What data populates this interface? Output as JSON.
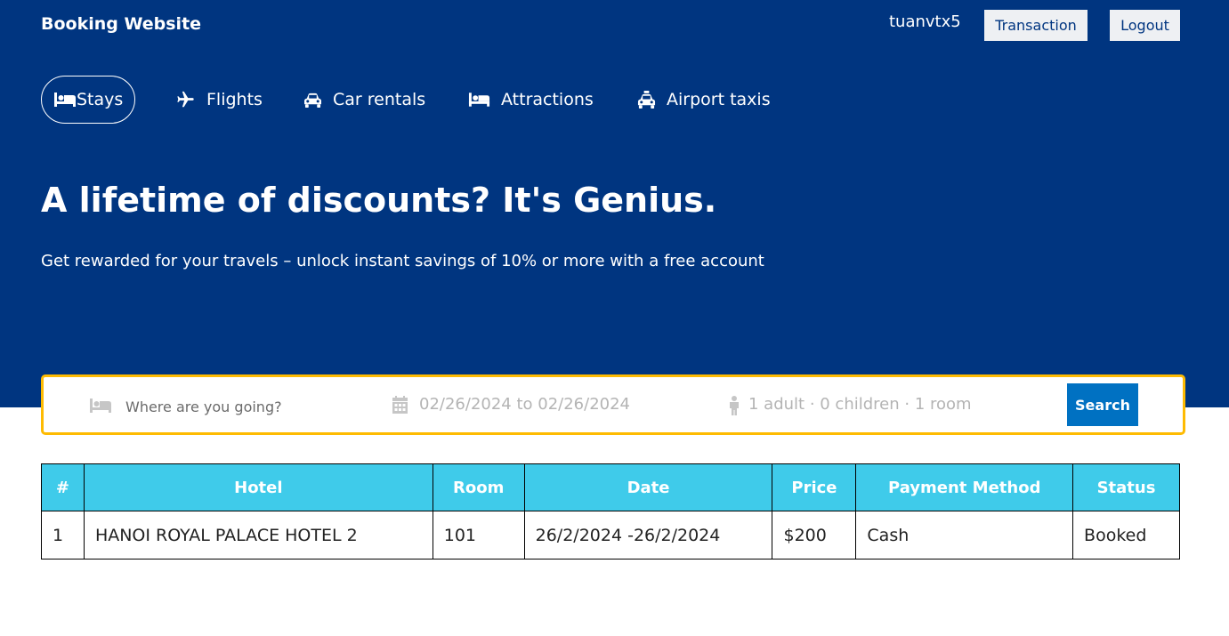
{
  "header": {
    "logo": "Booking Website",
    "username": "tuanvtx5",
    "transaction_label": "Transaction",
    "logout_label": "Logout"
  },
  "nav": {
    "items": [
      {
        "label": "Stays",
        "icon": "bed-icon",
        "active": true
      },
      {
        "label": "Flights",
        "icon": "plane-icon"
      },
      {
        "label": "Car rentals",
        "icon": "car-icon"
      },
      {
        "label": "Attractions",
        "icon": "bed-icon"
      },
      {
        "label": "Airport taxis",
        "icon": "taxi-icon"
      }
    ]
  },
  "hero": {
    "title": "A lifetime of discounts? It's Genius.",
    "subtitle": "Get rewarded for your travels – unlock instant savings of 10% or more with a free account"
  },
  "search": {
    "destination_placeholder": "Where are you going?",
    "date_range": "02/26/2024 to 02/26/2024",
    "guests": "1 adult · 0 children · 1 room",
    "button_label": "Search"
  },
  "table": {
    "headers": [
      "#",
      "Hotel",
      "Room",
      "Date",
      "Price",
      "Payment Method",
      "Status"
    ],
    "rows": [
      [
        "1",
        "HANOI ROYAL PALACE HOTEL 2",
        "101",
        "26/2/2024 -26/2/2024",
        "$200",
        "Cash",
        "Booked"
      ]
    ]
  },
  "colors": {
    "header_bg": "#003580",
    "search_border": "#febb02",
    "search_button": "#0071c2",
    "table_header": "#3fcbea"
  }
}
